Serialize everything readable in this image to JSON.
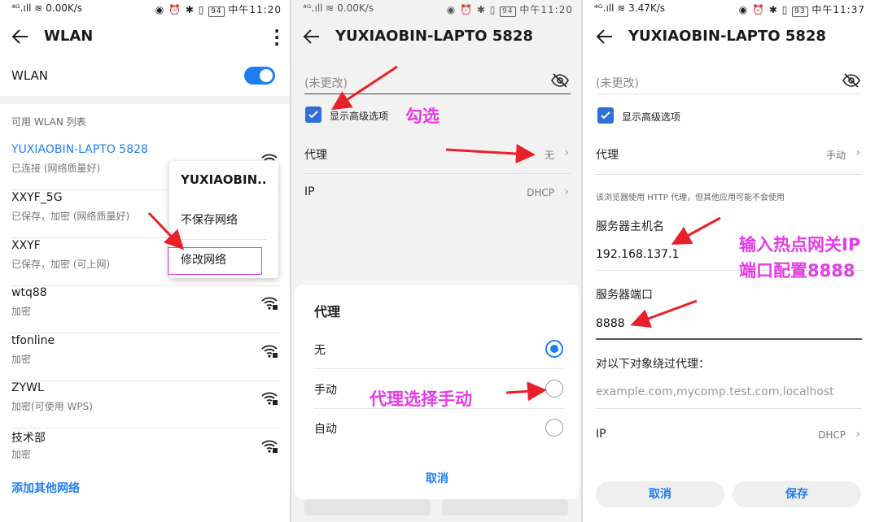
{
  "screens": [
    {
      "status": {
        "left": "⁴ᴳ.ıll ≋ 0.00K/s",
        "right": "◉ ⏰ ✱ ▯ ",
        "battery": "94",
        "time": "中午11:20"
      },
      "title": "WLAN",
      "wlan_label": "WLAN",
      "section_title": "可用 WLAN 列表",
      "networks": [
        {
          "name": "YUXIAOBIN-LAPTO 5828",
          "status": "已连接 (网络质量好)"
        },
        {
          "name": "XXYF_5G",
          "status": "已保存，加密 (网络质量好)"
        },
        {
          "name": "XXYF",
          "status": "已保存，加密 (可上网)"
        },
        {
          "name": "wtq88",
          "status": "加密"
        },
        {
          "name": "tfonline",
          "status": "加密"
        },
        {
          "name": "ZYWL",
          "status": "加密(可使用 WPS)"
        },
        {
          "name": "技术部",
          "status": "加密"
        }
      ],
      "add_network": "添加其他网络",
      "popup": {
        "title": "YUXIAOBIN..",
        "items": [
          "不保存网络",
          "修改网络"
        ]
      }
    },
    {
      "status": {
        "left": "⁴ᴳ.ıll ≋ 0.00K/s",
        "right": "◉ ⏰ ✱ ▯ ",
        "battery": "94",
        "time": "中午11:20"
      },
      "title": "YUXIAOBIN-LAPTO 5828",
      "password_placeholder": "(未更改)",
      "advanced_label": "显示高级选项",
      "proxy_label": "代理",
      "proxy_value": "无",
      "ip_label": "IP",
      "ip_value": "DHCP",
      "dialog": {
        "title": "代理",
        "options": [
          "无",
          "手动",
          "自动"
        ],
        "selected": "无",
        "cancel": "取消"
      },
      "annotations": [
        "勾选",
        "代理选择手动"
      ]
    },
    {
      "status": {
        "left": "⁴ᴳ.ıll ≋ 3.47K/s",
        "right": "◉ ⏰ ✱ ▯ ",
        "battery": "93",
        "time": "中午11:37"
      },
      "title": "YUXIAOBIN-LAPTO 5828",
      "password_placeholder": "(未更改)",
      "advanced_label": "显示高级选项",
      "proxy_label": "代理",
      "proxy_value": "手动",
      "hint": "该浏览器使用 HTTP 代理，但其他应用可能不会使用",
      "host_label": "服务器主机名",
      "host_value": "192.168.137.1",
      "port_label": "服务器端口",
      "port_value": "8888",
      "bypass_label": "对以下对象绕过代理：",
      "bypass_placeholder": "example.com,mycomp.test.com,localhost",
      "ip_label": "IP",
      "ip_value": "DHCP",
      "cancel": "取消",
      "save": "保存",
      "annotations": [
        "输入热点网关IP",
        "端口配置8888"
      ]
    }
  ],
  "colors": {
    "accent": "#1e7ff0",
    "annotation": "#e43be8",
    "arrow": "#e8202a"
  }
}
